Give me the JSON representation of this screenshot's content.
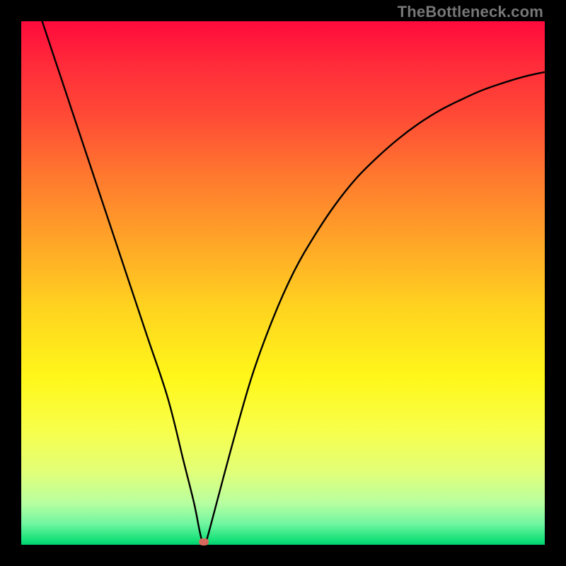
{
  "watermark": "TheBottleneck.com",
  "chart_data": {
    "type": "line",
    "title": "",
    "xlabel": "",
    "ylabel": "",
    "xlim": [
      0,
      100
    ],
    "ylim": [
      0,
      100
    ],
    "grid": false,
    "legend": false,
    "series": [
      {
        "name": "curve",
        "color": "#000000",
        "x": [
          4,
          8,
          12,
          16,
          20,
          24,
          28,
          31,
          33,
          34,
          34.6,
          35.2,
          36,
          40,
          44,
          48,
          52,
          56,
          60,
          64,
          68,
          72,
          76,
          80,
          84,
          88,
          92,
          96,
          100
        ],
        "y": [
          100,
          88,
          76,
          64,
          52,
          40,
          28,
          16,
          8,
          3,
          0.6,
          0.6,
          3,
          18,
          32,
          43,
          52,
          59,
          65,
          70,
          74,
          77.5,
          80.5,
          83,
          85,
          86.8,
          88.2,
          89.4,
          90.3
        ]
      }
    ],
    "marker": {
      "x": 34.9,
      "y": 0.5,
      "color": "#d9675b"
    },
    "background_gradient": {
      "top": "#ff0a3c",
      "bottom": "#00d070"
    }
  }
}
